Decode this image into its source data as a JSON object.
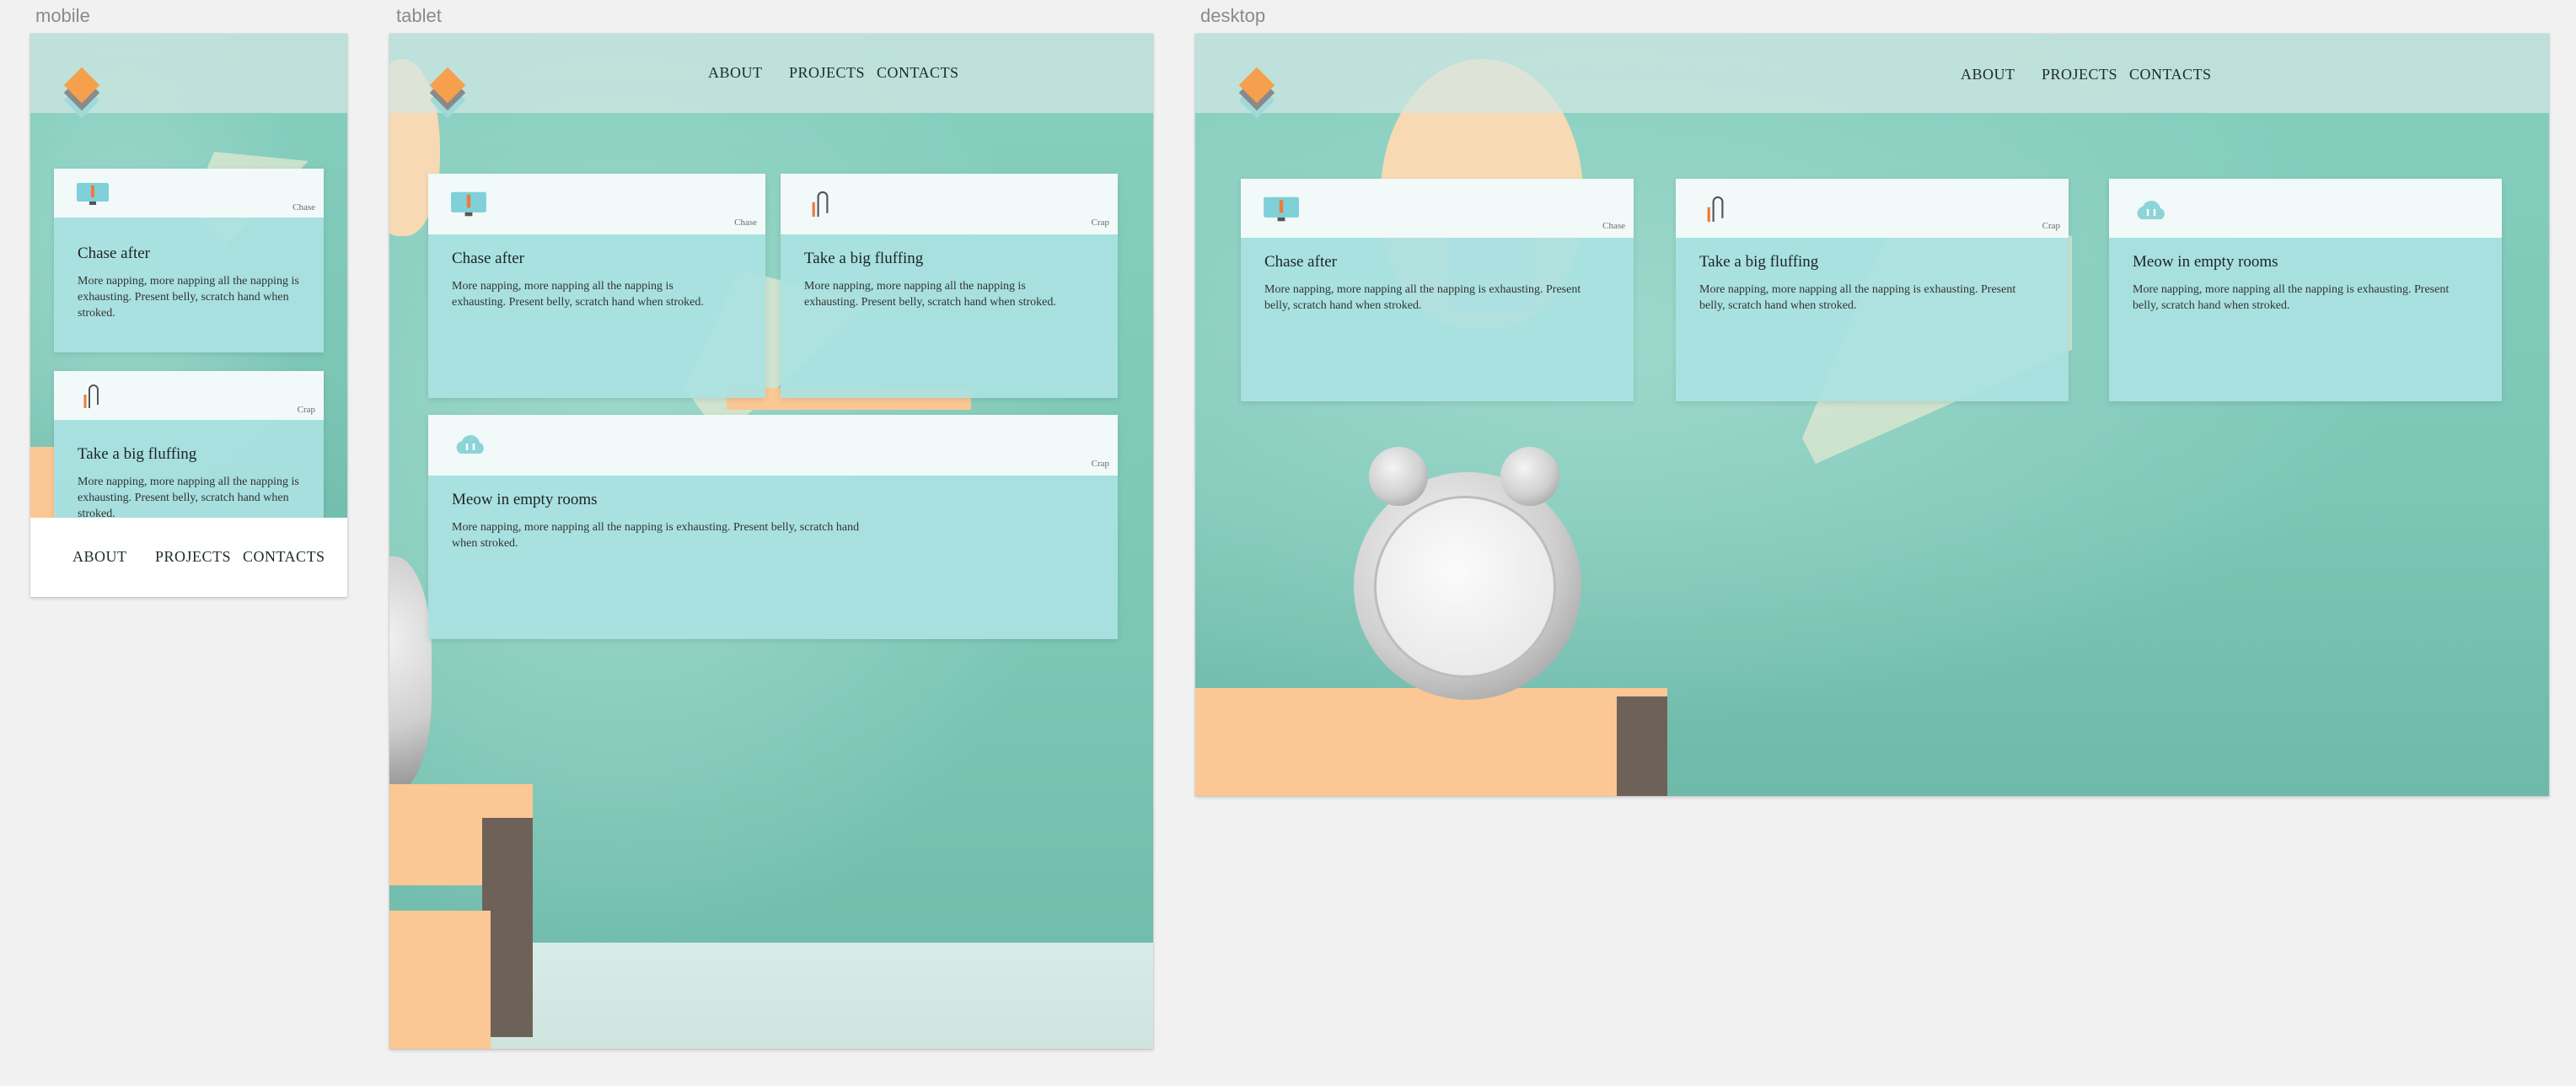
{
  "frames": {
    "mobile_label": "mobile",
    "tablet_label": "tablet",
    "desktop_label": "desktop"
  },
  "nav": {
    "about": "ABOUT",
    "projects": "PROJECTS",
    "contacts": "CONTACTS"
  },
  "cards": [
    {
      "title": "Chase after",
      "tag": "Chase",
      "text": "More napping, more napping all the napping is exhausting. Present belly, scratch hand when stroked.",
      "icon": "monitor-icon"
    },
    {
      "title": "Take a big fluffing",
      "tag": "Crap",
      "text": "More napping, more napping all the napping is exhausting. Present belly, scratch hand when stroked.",
      "icon": "paperclip-icon"
    },
    {
      "title": "Meow in empty rooms",
      "tag": "Crap",
      "text": "More napping, more napping all the napping is exhausting. Present belly, scratch hand when stroked.",
      "icon": "cloud-icon"
    }
  ],
  "colors": {
    "background": "#8ccfc1",
    "card": "#aae2e2",
    "card_header": "#f4fafa",
    "accent_orange": "#f6a04d",
    "book": "#fbc794"
  }
}
